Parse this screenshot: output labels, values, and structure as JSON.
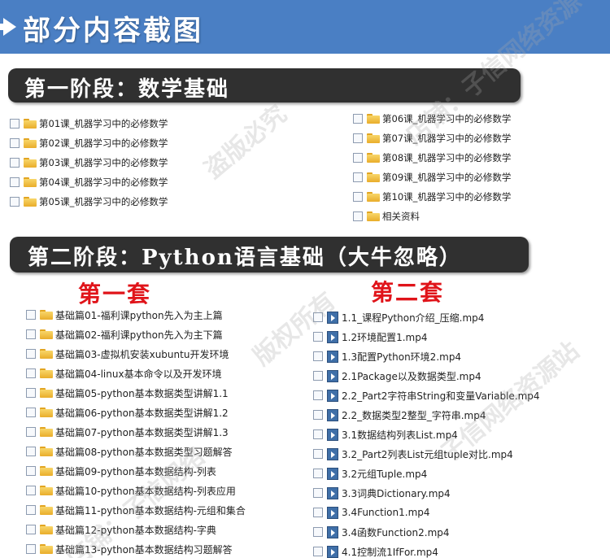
{
  "banner": {
    "title": "部分内容截图"
  },
  "stage1": {
    "title": "第一阶段：数学基础",
    "left_items": [
      "第01课_机器学习中的必修数学",
      "第02课_机器学习中的必修数学",
      "第03课_机器学习中的必修数学",
      "第04课_机器学习中的必修数学",
      "第05课_机器学习中的必修数学"
    ],
    "right_items": [
      "第06课_机器学习中的必修数学",
      "第07课_机器学习中的必修数学",
      "第08课_机器学习中的必修数学",
      "第09课_机器学习中的必修数学",
      "第10课_机器学习中的必修数学",
      "相关资料"
    ]
  },
  "stage2": {
    "title": "第二阶段：Python语言基础（大牛忽略）",
    "set1_title": "第一套",
    "set2_title": "第二套",
    "set1_items": [
      "基础篇01-福利课python先入为主上篇",
      "基础篇02-福利课python先入为主下篇",
      "基础篇03-虚拟机安装xubuntu开发环境",
      "基础篇04-linux基本命令以及开发环境",
      "基础篇05-python基本数据类型讲解1.1",
      "基础篇06-python基本数据类型讲解1.2",
      "基础篇07-python基本数据类型讲解1.3",
      "基础篇08-python基本数据类型习题解答",
      "基础篇09-python基本数据结构-列表",
      "基础篇10-python基本数据结构-列表应用",
      "基础篇11-python基本数据结构-元组和集合",
      "基础篇12-python基本数据结构-字典",
      "基础篇13-python基本数据结构习题解答"
    ],
    "set2_items": [
      "1.1_课程Python介绍_压缩.mp4",
      "1.2环境配置1.mp4",
      "1.3配置Python环境2.mp4",
      "2.1Package以及数据类型.mp4",
      "2.2_Part2字符串String和变量Variable.mp4",
      "2.2_数据类型2整型_字符串.mp4",
      "3.1数据结构列表List.mp4",
      "3.2_Part2列表List元组tuple对比.mp4",
      "3.2元组Tuple.mp4",
      "3.3词典Dictionary.mp4",
      "3.4Function1.mp4",
      "3.4函数Function2.mp4",
      "4.1控制流1IfFor.mp4"
    ]
  },
  "watermarks": [
    "版权所有",
    "子信网络",
    "盗版必究",
    "店铺："
  ],
  "icons": {
    "folder": "folder-icon",
    "video": "video-file-icon",
    "checkbox": "checkbox",
    "arrow": "arrow-right-icon"
  }
}
